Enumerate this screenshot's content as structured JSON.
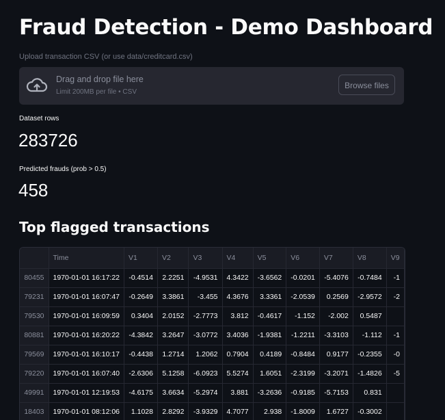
{
  "app": {
    "title": "Fraud Detection - Demo Dashboard"
  },
  "uploader": {
    "label": "Upload transaction CSV (or use data/creditcard.csv)",
    "drop_text": "Drag and drop file here",
    "limit_text": "Limit 200MB per file • CSV",
    "browse_label": "Browse files",
    "icon": "cloud-upload-icon"
  },
  "metrics": {
    "rows_label": "Dataset rows",
    "rows_value": "283726",
    "frauds_label": "Predicted frauds (prob > 0.5)",
    "frauds_value": "458"
  },
  "section": {
    "title": "Top flagged transactions"
  },
  "table": {
    "columns": [
      "",
      "Time",
      "V1",
      "V2",
      "V3",
      "V4",
      "V5",
      "V6",
      "V7",
      "V8",
      "V9"
    ],
    "rows": [
      [
        "80455",
        "1970-01-01 16:17:22",
        "-0.4514",
        "2.2251",
        "-4.9531",
        "4.3422",
        "-3.6562",
        "-0.0201",
        "-5.4076",
        "-0.7484",
        "-1"
      ],
      [
        "79231",
        "1970-01-01 16:07:47",
        "-0.2649",
        "3.3861",
        "-3.455",
        "4.3676",
        "3.3361",
        "-2.0539",
        "0.2569",
        "-2.9572",
        "-2"
      ],
      [
        "79530",
        "1970-01-01 16:09:59",
        "0.3404",
        "2.0152",
        "-2.7773",
        "3.812",
        "-0.4617",
        "-1.152",
        "-2.002",
        "0.5487",
        ""
      ],
      [
        "80881",
        "1970-01-01 16:20:22",
        "-4.3842",
        "3.2647",
        "-3.0772",
        "3.4036",
        "-1.9381",
        "-1.2211",
        "-3.3103",
        "-1.112",
        "-1"
      ],
      [
        "79569",
        "1970-01-01 16:10:17",
        "-0.4438",
        "1.2714",
        "1.2062",
        "0.7904",
        "0.4189",
        "-0.8484",
        "0.9177",
        "-0.2355",
        "-0"
      ],
      [
        "79220",
        "1970-01-01 16:07:40",
        "-2.6306",
        "5.1258",
        "-6.0923",
        "5.5274",
        "1.6051",
        "-2.3199",
        "-3.2071",
        "-1.4826",
        "-5"
      ],
      [
        "49991",
        "1970-01-01 12:19:53",
        "-4.6175",
        "3.6634",
        "-5.2974",
        "3.881",
        "-3.2636",
        "-0.9185",
        "-5.7153",
        "0.831",
        ""
      ],
      [
        "18403",
        "1970-01-01 08:12:06",
        "1.1028",
        "2.8292",
        "-3.9329",
        "4.7077",
        "2.938",
        "-1.8009",
        "1.6727",
        "-0.3002",
        ""
      ]
    ]
  }
}
